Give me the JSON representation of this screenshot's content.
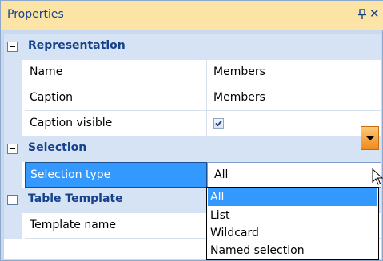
{
  "panel": {
    "title": "Properties"
  },
  "categories": {
    "representation": "Representation",
    "selection": "Selection",
    "table_template": "Table Template"
  },
  "properties": {
    "name": {
      "label": "Name",
      "value": "Members"
    },
    "caption": {
      "label": "Caption",
      "value": "Members"
    },
    "caption_visible": {
      "label": "Caption visible",
      "checked": true
    },
    "selection_type": {
      "label": "Selection type",
      "value": "All"
    },
    "template_name": {
      "label": "Template name",
      "value": ""
    }
  },
  "dropdown": {
    "options": [
      "All",
      "List",
      "Wildcard",
      "Named selection"
    ],
    "highlighted": "All"
  },
  "colors": {
    "title_bg": "#fbe4a6",
    "category_bg": "#d6e3f5",
    "selection": "#3399ff",
    "dropdown_button": "#f08a1c"
  }
}
